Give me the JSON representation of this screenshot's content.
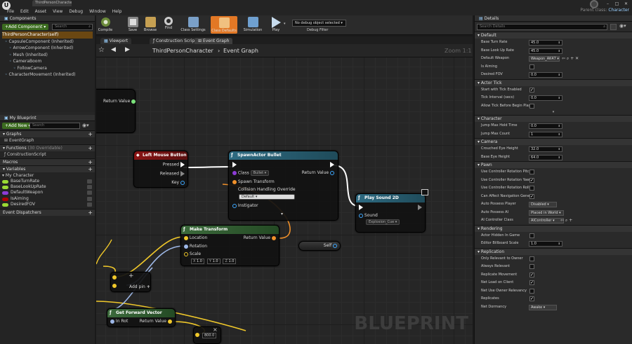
{
  "window": {
    "tab_title": "ThirdPersonCharacter",
    "parent_class_label": "Parent class:",
    "parent_class_value": "Character",
    "min": "–",
    "max": "□",
    "close": "✕"
  },
  "menu": [
    "File",
    "Edit",
    "Asset",
    "View",
    "Debug",
    "Window",
    "Help"
  ],
  "components": {
    "header": "Components",
    "add_button": "+Add Component ▾",
    "search_placeholder": "Search",
    "items": [
      "ThirdPersonCharacter(self)",
      "CapsuleComponent (Inherited)",
      "ArrowComponent (Inherited)",
      "Mesh (Inherited)",
      "CameraBoom",
      "FollowCamera",
      "CharacterMovement (Inherited)"
    ]
  },
  "myblueprint": {
    "header": "My Blueprint",
    "add_button": "+Add New ▾",
    "search_placeholder": "Search",
    "graphs_label": "Graphs",
    "event_graph": "EventGraph",
    "functions_label": "Functions",
    "functions_count": "(30 Overridable)",
    "construction_script": "ConstructionScript",
    "macros_label": "Macros",
    "variables_label": "Variables",
    "my_character": "My Character",
    "variables": [
      {
        "name": "BaseTurnRate",
        "color": "#9ad934"
      },
      {
        "name": "BaseLookUpRate",
        "color": "#9ad934"
      },
      {
        "name": "DefaultWeapon",
        "color": "#8d3cd6"
      },
      {
        "name": "IsAiming",
        "color": "#b00000"
      },
      {
        "name": "DesiredFOV",
        "color": "#9ad934"
      }
    ],
    "event_dispatchers": "Event Dispatchers"
  },
  "toolbar": {
    "compile": "Compile",
    "save": "Save",
    "browse": "Browse",
    "find": "Find",
    "class_settings": "Class Settings",
    "class_defaults": "Class Defaults",
    "simulation": "Simulation",
    "play": "Play",
    "debug_object": "No debug object selected ▾",
    "debug_filter": "Debug Filter"
  },
  "graphtabs": {
    "viewport": "Viewport",
    "construction": "Construction Scrip",
    "event": "Event Graph"
  },
  "breadcrumb": {
    "part1": "ThirdPersonCharacter",
    "sep": "›",
    "part2": "Event Graph",
    "zoom": "Zoom 1:1"
  },
  "watermark": "BLUEPRINT",
  "nodes": {
    "return_value": "Return Value",
    "lmb": {
      "title": "Left Mouse Button",
      "pressed": "Pressed",
      "released": "Released",
      "key": "Key"
    },
    "spawn": {
      "title": "SpawnActor Bullet",
      "class": "Class",
      "class_val": "Bullet ▾",
      "spawn_transform": "Spawn Transform",
      "collision": "Collision Handling Override",
      "collision_val": "Default ▾",
      "instigator": "Instigator",
      "return": "Return Value",
      "more": "▾"
    },
    "sound": {
      "title": "Play Sound 2D",
      "sound": "Sound",
      "sound_val": "Explosion_Cue ▾"
    },
    "make_transform": {
      "title": "Make Transform",
      "location": "Location",
      "rotation": "Rotation",
      "scale": "Scale",
      "x": "X",
      "y": "Y",
      "z": "Z",
      "sx": "1.0",
      "sy": "1.0",
      "sz": "1.0",
      "return": "Return Value"
    },
    "self": "Self",
    "add": {
      "add_pin": "Add pin",
      "plus": "+"
    },
    "fwd": {
      "title": "Get Forward Vector",
      "in_rot": "In Rot",
      "return": "Return Value"
    },
    "mult": {
      "symbol": "×",
      "value": "800.0"
    }
  },
  "details": {
    "header": "Details",
    "search_placeholder": "Search Details",
    "sections": [
      {
        "title": "Default",
        "rows": [
          {
            "label": "Base Turn Rate",
            "type": "num",
            "value": "45.0"
          },
          {
            "label": "Base Look Up Rate",
            "type": "num",
            "value": "45.0"
          },
          {
            "label": "Default Weapon",
            "type": "asset",
            "value": "Weapon_AK47 ▾"
          },
          {
            "label": "Is Aiming",
            "type": "check",
            "value": ""
          },
          {
            "label": "Desired FOV",
            "type": "num",
            "value": "0.0"
          }
        ]
      },
      {
        "title": "Actor Tick",
        "rows": [
          {
            "label": "Start with Tick Enabled",
            "type": "check",
            "value": "✓"
          },
          {
            "label": "Tick Interval (secs)",
            "type": "num",
            "value": "0.0"
          },
          {
            "label": "Allow Tick Before Begin Play",
            "type": "check",
            "value": ""
          }
        ]
      },
      {
        "title": "Character",
        "rows": [
          {
            "label": "Jump Max Hold Time",
            "type": "num",
            "value": "0.0"
          },
          {
            "label": "Jump Max Count",
            "type": "num",
            "value": "1"
          }
        ]
      },
      {
        "title": "Camera",
        "rows": [
          {
            "label": "Crouched Eye Height",
            "type": "num",
            "value": "32.0"
          },
          {
            "label": "Base Eye Height",
            "type": "num",
            "value": "64.0"
          }
        ]
      },
      {
        "title": "Pawn",
        "rows": [
          {
            "label": "Use Controller Rotation Pitch",
            "type": "check",
            "value": ""
          },
          {
            "label": "Use Controller Rotation Yaw",
            "type": "check",
            "value": "✓"
          },
          {
            "label": "Use Controller Rotation Roll",
            "type": "check",
            "value": ""
          },
          {
            "label": "Can Affect Navigation Gener",
            "type": "check",
            "value": "✓"
          },
          {
            "label": "Auto Possess Player",
            "type": "drop",
            "value": "Disabled ▾"
          },
          {
            "label": "Auto Possess AI",
            "type": "drop",
            "value": "Placed in World ▾"
          },
          {
            "label": "AI Controller Class",
            "type": "drop",
            "value": "AIController ▾"
          }
        ]
      },
      {
        "title": "Rendering",
        "rows": [
          {
            "label": "Actor Hidden In Game",
            "type": "check",
            "value": ""
          },
          {
            "label": "Editor Billboard Scale",
            "type": "num",
            "value": "1.0"
          }
        ]
      },
      {
        "title": "Replication",
        "rows": [
          {
            "label": "Only Relevant to Owner",
            "type": "check",
            "value": ""
          },
          {
            "label": "Always Relevant",
            "type": "check",
            "value": ""
          },
          {
            "label": "Replicate Movement",
            "type": "check",
            "value": "✓"
          },
          {
            "label": "Net Load on Client",
            "type": "check",
            "value": "✓"
          },
          {
            "label": "Net Use Owner Relevancy",
            "type": "check",
            "value": ""
          },
          {
            "label": "Replicates",
            "type": "check",
            "value": "✓"
          },
          {
            "label": "Net Dormancy",
            "type": "drop",
            "value": "Awake ▾"
          }
        ]
      }
    ]
  }
}
